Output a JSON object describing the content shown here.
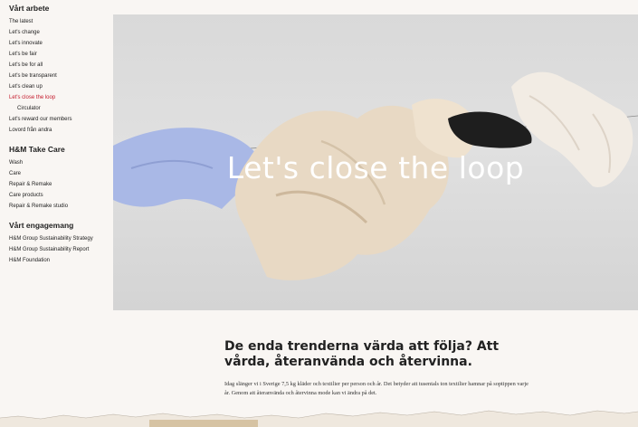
{
  "sidebar": {
    "vart_arbete": {
      "title": "Vårt arbete",
      "items": [
        {
          "label": "The latest"
        },
        {
          "label": "Let's change"
        },
        {
          "label": "Let's innovate"
        },
        {
          "label": "Let's be fair"
        },
        {
          "label": "Let's be for all"
        },
        {
          "label": "Let's be transparent"
        },
        {
          "label": "Let's clean up"
        },
        {
          "label": "Let's close the loop"
        },
        {
          "label": "Circulator"
        },
        {
          "label": "Let's reward our members"
        },
        {
          "label": "Lovord från andra"
        }
      ]
    },
    "take_care": {
      "title": "H&M Take Care",
      "items": [
        {
          "label": "Wash"
        },
        {
          "label": "Care"
        },
        {
          "label": "Repair & Remake"
        },
        {
          "label": "Care products"
        },
        {
          "label": "Repair & Remake studio"
        }
      ]
    },
    "engagemang": {
      "title": "Vårt engagemang",
      "items": [
        {
          "label": "H&M Group Sustainability Strategy"
        },
        {
          "label": "H&M Group Sustainability Report"
        },
        {
          "label": "H&M Foundation"
        }
      ]
    }
  },
  "hero": {
    "title": "Let's close the loop",
    "image": "clothes-on-washing-line"
  },
  "content": {
    "headline": "De enda trenderna värda att följa? Att vårda, återanvända och återvinna.",
    "body": "Idag slänger vi i Sverige 7,5 kg kläder och textilier per person och år. Det betyder att tusentals ton textilier hamnar på soptippen varje år. Genom att återanvända och återvinna mode kan vi ändra på det."
  },
  "colors": {
    "background": "#f9f6f3",
    "active_link": "#c4182a",
    "hero_sky": "#dcdcdc"
  }
}
